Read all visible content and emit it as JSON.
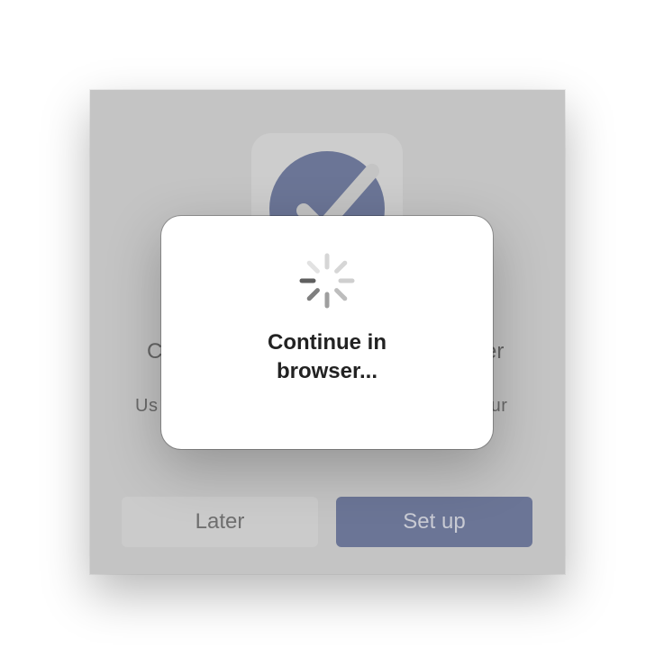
{
  "background_dialog": {
    "title_left_fragment": "C",
    "title_right_fragment": "er",
    "body_left_fragment": "Us",
    "body_right_fragment": "our",
    "later_label": "Later",
    "setup_label": "Set up",
    "icon": "checkmark-badge-icon",
    "accent_color": "#6b7596"
  },
  "loading_modal": {
    "spinner_icon": "loading-spinner-icon",
    "message_line1": "Continue in",
    "message_line2": "browser..."
  }
}
